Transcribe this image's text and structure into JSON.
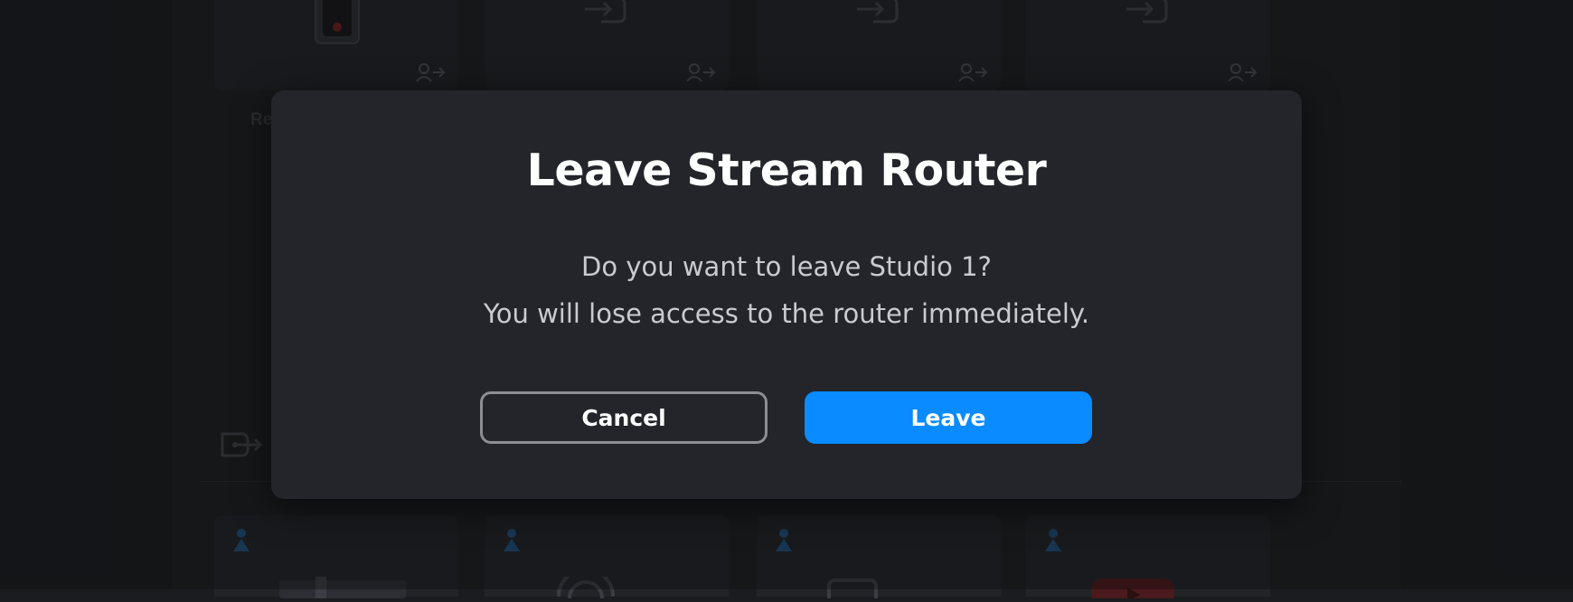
{
  "background": {
    "partial_label": "Re"
  },
  "dialog": {
    "title": "Leave Stream Router",
    "message_line1": "Do you want to leave Studio 1?",
    "message_line2": "You will lose access to the router immediately.",
    "cancel_label": "Cancel",
    "leave_label": "Leave"
  },
  "colors": {
    "primary": "#0a8bff",
    "dialog_bg": "#23252a",
    "page_bg": "#1b1c1f"
  }
}
